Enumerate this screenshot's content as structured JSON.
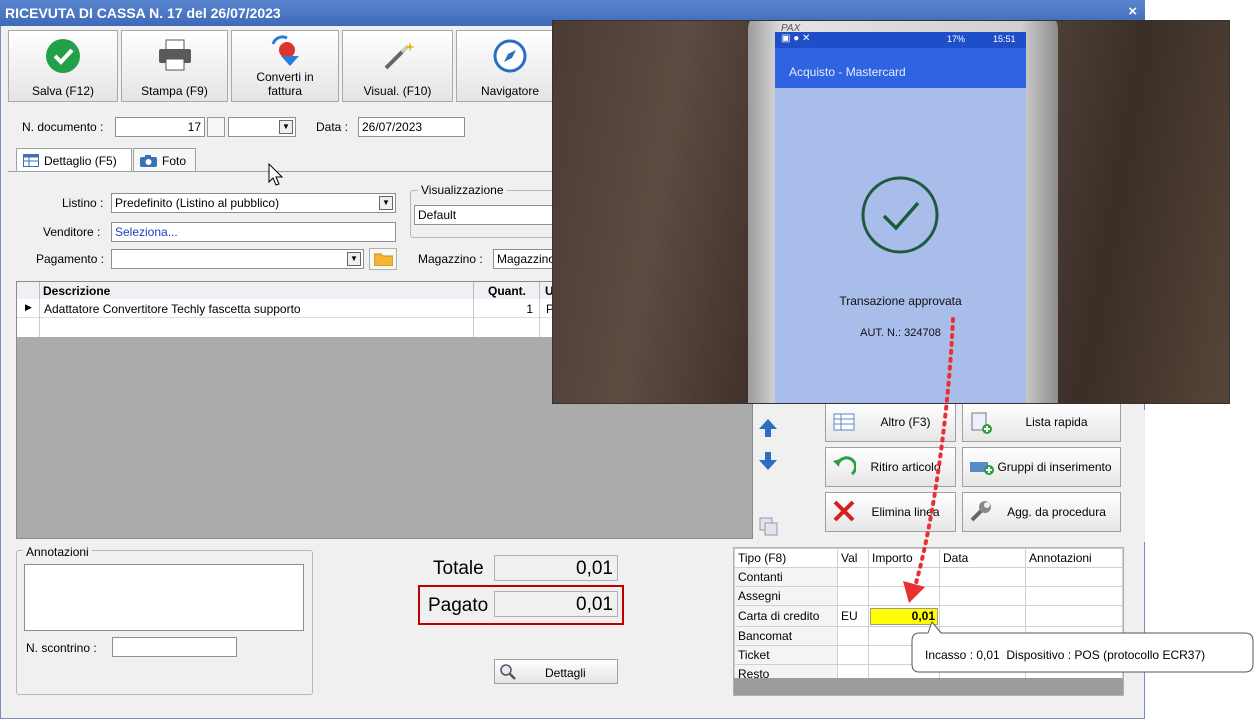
{
  "window": {
    "title": "RICEVUTA DI CASSA N. 17 del 26/07/2023",
    "close": "×"
  },
  "toolbar": {
    "save": "Salva (F12)",
    "print": "Stampa (F9)",
    "convert": "Converti in fattura",
    "view": "Visual. (F10)",
    "navigator": "Navigatore"
  },
  "form": {
    "doc_number_label": "N. documento :",
    "doc_number": "17",
    "date_label": "Data :",
    "date": "26/07/2023",
    "listino_label": "Listino :",
    "listino": "Predefinito (Listino al pubblico)",
    "venditore_label": "Venditore :",
    "venditore": "Seleziona...",
    "pagamento_label": "Pagamento :",
    "pagamento": "",
    "visualizzazione_label": "Visualizzazione",
    "visualizzazione": "Default",
    "magazzino_label": "Magazzino :",
    "magazzino": "Magazzino"
  },
  "tabs": {
    "details": "Dettaglio (F5)",
    "photo": "Foto"
  },
  "grid": {
    "headers": {
      "descrizione": "Descrizione",
      "quant": "Quant.",
      "u": "U"
    },
    "rows": [
      {
        "descrizione": "Adattatore Convertitore Techly fascetta supporto",
        "quant": "1",
        "u": "P"
      }
    ]
  },
  "side_buttons": {
    "altro": "Altro (F3)",
    "lista_rapida": "Lista rapida",
    "ritiro": "Ritiro articolo",
    "gruppi": "Gruppi di inserimento",
    "elimina": "Elimina linea",
    "agg": "Agg. da procedura"
  },
  "notes": {
    "label": "Annotazioni",
    "scontrino_label": "N. scontrino :"
  },
  "totals": {
    "totale_label": "Totale",
    "totale": "0,01",
    "pagato_label": "Pagato",
    "pagato": "0,01",
    "dettagli": "Dettagli"
  },
  "payments": {
    "headers": {
      "tipo": "Tipo (F8)",
      "val": "Val",
      "importo": "Importo",
      "data": "Data",
      "annotazioni": "Annotazioni"
    },
    "rows": [
      {
        "tipo": "Contanti",
        "val": "",
        "importo": ""
      },
      {
        "tipo": "Assegni",
        "val": "",
        "importo": ""
      },
      {
        "tipo": "Carta di credito",
        "val": "EU",
        "importo": "0,01"
      },
      {
        "tipo": "Bancomat",
        "val": "",
        "importo": ""
      },
      {
        "tipo": "Ticket",
        "val": "",
        "importo": ""
      },
      {
        "tipo": "Resto",
        "val": "",
        "importo": ""
      }
    ]
  },
  "tooltip": "Incasso : 0,01  Dispositivo : POS (protocollo ECR37)",
  "pos": {
    "brand": "PAX",
    "time": "15:51",
    "battery": "17%",
    "header": "Acquisto - Mastercard",
    "status": "Transazione approvata",
    "auth": "AUT. N.: 324708"
  },
  "colors": {
    "highlight": "#ffff00",
    "accent_red": "#c00000",
    "pos_header": "#2f63e0",
    "pos_screen": "#a8bde9"
  }
}
